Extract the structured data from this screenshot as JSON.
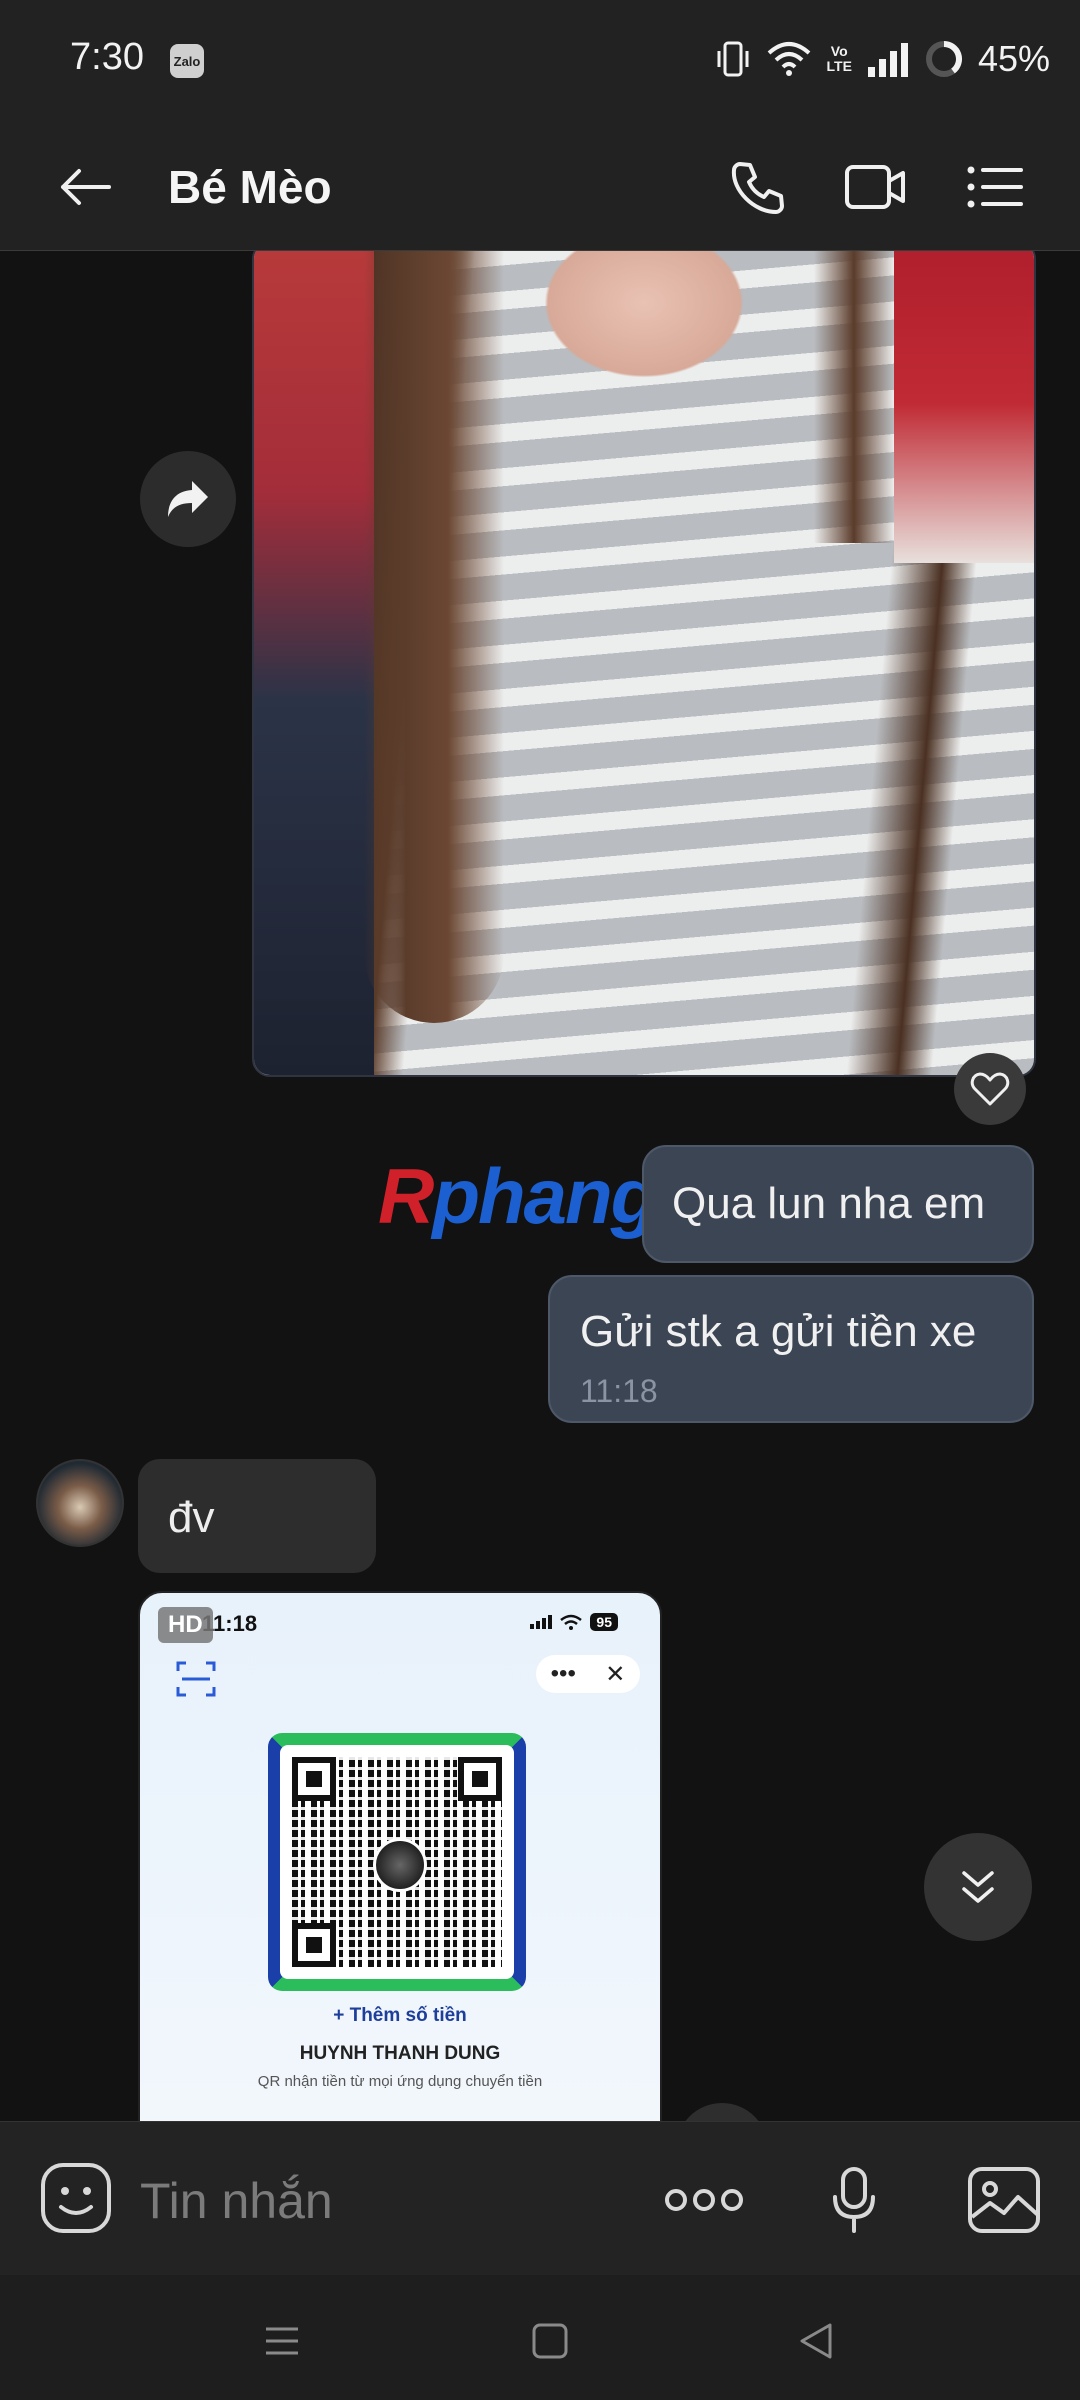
{
  "status_bar": {
    "time": "7:30",
    "notification_app": "Zalo",
    "volte_line1": "Vo",
    "volte_line2": "LTE",
    "battery": "45%"
  },
  "header": {
    "contact_name": "Bé Mèo",
    "icons": [
      "back-arrow-icon",
      "phone-icon",
      "video-call-icon",
      "menu-list-icon"
    ]
  },
  "watermark": {
    "first": "R",
    "rest": "phang"
  },
  "messages": {
    "outgoing_1": {
      "text": "Qua lun nha em"
    },
    "outgoing_2": {
      "text": "Gửi stk a gửi tiền xe",
      "time": "11:18"
    },
    "incoming_1": {
      "text": "đv"
    }
  },
  "qr_image": {
    "hd_badge": "HD",
    "time": "11:18",
    "battery": "95",
    "menu_dots": "•••",
    "menu_close": "✕",
    "add_amount": "+ Thêm số tiền",
    "account_name": "HUYNH THANH DUNG",
    "description": "QR nhận tiền từ mọi ứng dụng chuyển tiền"
  },
  "input_bar": {
    "placeholder": "Tin nhắn",
    "more_label": "ooo"
  },
  "colors": {
    "outgoing_bubble": "#3c4553",
    "incoming_bubble": "#2d2d2d",
    "background": "#121212",
    "header": "#222222"
  }
}
